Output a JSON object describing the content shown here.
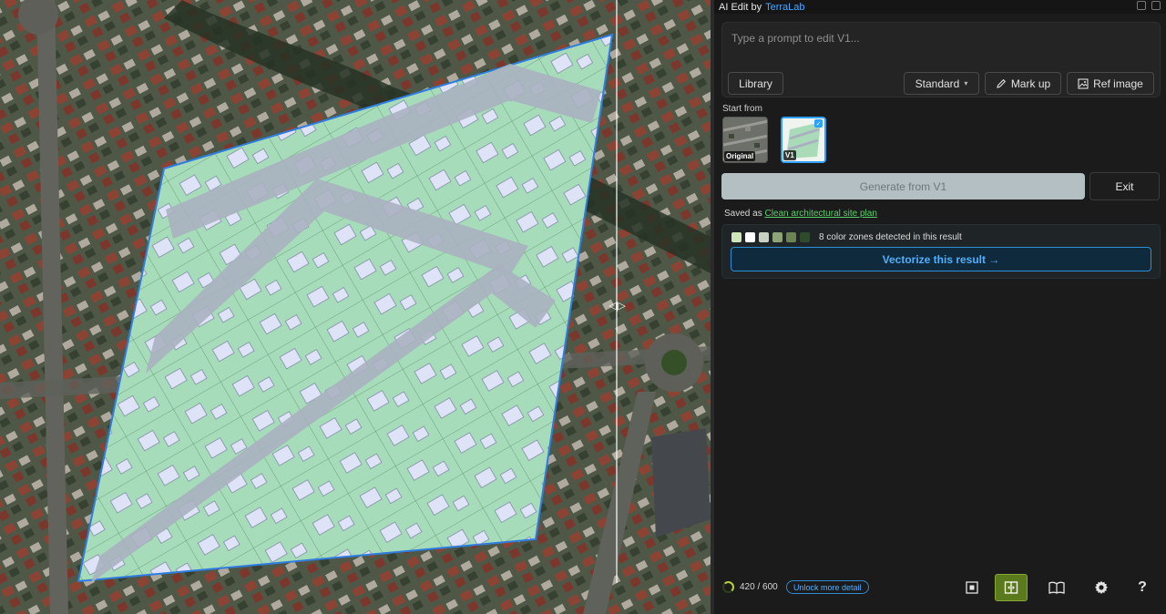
{
  "panel": {
    "title": "AI Edit by",
    "brand": "TerraLab",
    "prompt_placeholder": "Type a prompt to edit V1...",
    "buttons": {
      "library": "Library",
      "standard": "Standard",
      "markup": "Mark up",
      "ref_image": "Ref image"
    },
    "start_from": {
      "label": "Start from",
      "original": "Original",
      "v1": "V1"
    },
    "generate": "Generate from V1",
    "exit": "Exit",
    "saved": {
      "prefix": "Saved as",
      "name": "Clean architectural site plan"
    },
    "zones": {
      "colors": [
        "#cfe6bb",
        "#ffffff",
        "#c9d1c2",
        "#8fa476",
        "#6c8354",
        "#2f4a2c"
      ],
      "text": "8 color zones detected in this result",
      "vectorize": "Vectorize this result →"
    },
    "footer": {
      "credits": "420 / 600",
      "credits_progress": 0.7,
      "unlock": "Unlock more detail"
    }
  },
  "icons": {
    "markup": "pencil-icon",
    "ref_image": "image-icon",
    "frame": "frame-icon",
    "compare": "compare-icon",
    "book": "book-icon",
    "gear": "gear-icon",
    "help": "help-icon"
  },
  "colors": {
    "accent": "#2ea1ff",
    "active_tool": "#5b7a1c",
    "saved_link": "#57d06a",
    "plan_fill": "#a6dcb9",
    "plan_border": "#2f7de0"
  }
}
